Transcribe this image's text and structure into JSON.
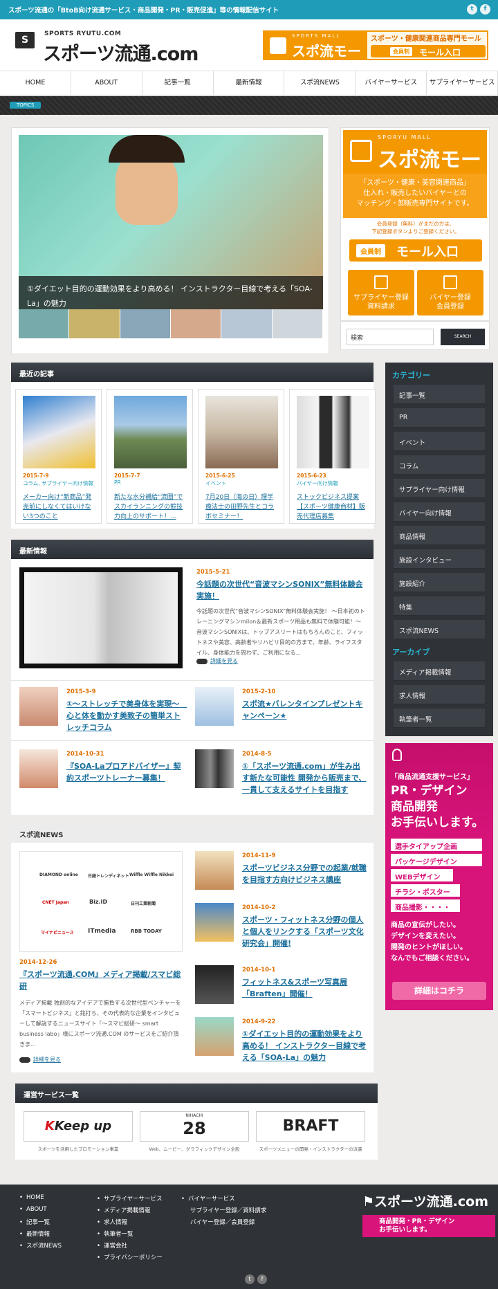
{
  "topbar": {
    "text": "スポーツ流通の「BtoB向け流通サービス・商品開発・PR・販売促進」等の情報配信サイト"
  },
  "header": {
    "logo_sub": "SPORTS RYUTU.COM",
    "logo_main": "スポーツ流通.com",
    "logo_flag": "S",
    "mall": {
      "en": "SPORTS MALL",
      "name": "スポ流モール",
      "desc": "スポーツ・健康関連商品専門モール",
      "tag": "会員制",
      "enter": "モール入口"
    }
  },
  "nav": [
    "HOME",
    "ABOUT",
    "記事一覧",
    "最新情報",
    "スポ流NEWS",
    "バイヤーサービス",
    "サプライヤーサービス"
  ],
  "topics_label": "TOPICS",
  "hero": {
    "caption": "①ダイエット目的の運動効果をより高める！ インストラクター目線で考える「SOA-La」の魅力"
  },
  "mall_side": {
    "en": "SPORYU MALL",
    "name": "スポ流モール",
    "desc1": "「スポーツ・健康・美容関連商品」",
    "desc2": "仕入れ・販売したいバイヤーとの",
    "desc3": "マッチング・卸販売専門サイトです。",
    "note1": "会員登録（無料）がまだの方は、",
    "note2": "下記登録ボタンよりご登録ください。",
    "tag": "会員制",
    "enter": "モール入口",
    "btn1a": "サプライヤー登録",
    "btn1b": "資料請求",
    "btn2a": "バイヤー登録",
    "btn2b": "会員登録"
  },
  "search": {
    "value": "検索",
    "button": "SEARCH"
  },
  "recent": {
    "title": "最近の記事",
    "items": [
      {
        "date": "2015-7-9",
        "cat": "コラム, サプライヤー向け情報",
        "title": "メーカー向け“新商品”発売前にしなくてはいけない3つのこと"
      },
      {
        "date": "2015-7-7",
        "cat": "PR",
        "title": "新たな水分補給“流圏”でスカイランニングの競技力向上のサポート！..."
      },
      {
        "date": "2015-6-25",
        "cat": "イベント",
        "title": "7月20日（海の日）理学療法士の田野先生とコラボセミナー！"
      },
      {
        "date": "2015-6-23",
        "cat": "バイヤー向け情報",
        "title": "ストックビジネス提案 【スポーツ健康商材】販売代理店募集"
      }
    ]
  },
  "news": {
    "title": "最新情報",
    "main": {
      "date": "2015-5-21",
      "title": "今話題の次世代“音波マシンSONIX”無料体験会実施！",
      "body": "今話題の次世代“音波マシンSONIX”無料体験会実施！ 〜日本初のトレーニングマシンmilon＆最新スポーツ用品も無料で体験可能！〜 音波マシンSONIXは、トップアスリートはもちろんのこと、フィットネスや美容、高齢者やリハビリ目的の方まで、年齢、ライフスタイル、身体能力を問わず、ご利用になる...",
      "more": "詳細を見る"
    },
    "items": [
      {
        "date": "2015-3-9",
        "title": "①〜ストレッチで美身体を実現〜　心と体を動かす美致子の簡単ストレッチコラム"
      },
      {
        "date": "2015-2-10",
        "title": "スポ流★バレンタインプレゼントキャンペーン★"
      },
      {
        "date": "2014-10-31",
        "title": "『SOA-Laプロアドバイザー』契約スポーツトレーナー募集！"
      },
      {
        "date": "2014-8-5",
        "title": "①「スポーツ流通.com」が生み出す新たな可能性 開発から販売まで、一貫して支えるサイトを目指す"
      }
    ]
  },
  "sidebar": {
    "cat_title": "カテゴリー",
    "categories": [
      "記事一覧",
      "PR",
      "イベント",
      "コラム",
      "サプライヤー向け情報",
      "バイヤー向け情報",
      "商品情報",
      "施設インタビュー",
      "施設紹介",
      "特集",
      "スポ流NEWS"
    ],
    "arch_title": "アーカイブ",
    "archives": [
      "メディア掲載情報",
      "求人情報",
      "執筆者一覧"
    ]
  },
  "pr_banner": {
    "head": "「商品流通支援サービス」",
    "l1": "PR・デザイン",
    "l2": "商品開発",
    "l3": "お手伝いします。",
    "items": [
      "選手タイアップ企画",
      "パッケージデザイン",
      "WEBデザイン",
      "チラシ・ポスター",
      "商品撮影・・・・"
    ],
    "m1": "商品の宣伝がしたい。",
    "m2": "デザインを変えたい。",
    "m3": "開発のヒントがほしい。",
    "m4": "なんでもご相談ください。",
    "btn": "詳細はコチラ"
  },
  "spo_news": {
    "title": "スポ流NEWS",
    "logos": [
      "DIAMOND online",
      "日経トレンディネット",
      "Wiffle Wiffle Nikkei",
      "CNET Japan",
      "Biz.ID",
      "日刊工業新聞",
      "マイナビニュース",
      "ITmedia",
      "RBB TODAY"
    ],
    "main": {
      "date": "2014-12-26",
      "title": "『スポーツ流通.COM』メディア掲載/スマビ総研",
      "body": "メディア掲載 独創的なアイデアで勝負する次世代型ベンチャーを「スマートビジネス」と銘打ち、その代表的な企業をインタビューして解説するニュースサイト「〜スマビ総研〜 smart business labo」様にスポーツ流通.COM のサービスをご紹介頂きま...",
      "more": "詳細を見る"
    },
    "items": [
      {
        "date": "2014-11-9",
        "title": "スポーツビジネス分野での起業/就職を目指す方向けビジネス講座"
      },
      {
        "date": "2014-10-2",
        "title": "スポーツ・フィットネス分野の個人と個人をリンクする「スポーツ文化研究会」開催!"
      },
      {
        "date": "2014-10-1",
        "title": "フィットネス&スポーツ写真展「Braften」開催！"
      },
      {
        "date": "2014-9-22",
        "title": "①ダイエット目的の運動効果をより高める！ インストラクター目線で考える「SOA-La」の魅力"
      }
    ]
  },
  "services": {
    "title": "運営サービス一覧",
    "items": [
      {
        "logo": "Keep up",
        "caption": "スポーツを活用したプロモーション事業"
      },
      {
        "logo": "28",
        "logo_sub": "NIHACHI",
        "caption": "Web、ムービー、グラフィックデザイン全般"
      },
      {
        "logo": "BRAFT",
        "caption": "スポーツメニューの開発・インストラクターの派遣"
      }
    ]
  },
  "footer": {
    "col1": [
      "HOME",
      "ABOUT",
      "記事一覧",
      "最新情報",
      "スポ流NEWS"
    ],
    "col2": [
      "サプライヤーサービス",
      "メディア掲載情報",
      "求人情報",
      "執筆者一覧",
      "運営会社",
      "プライバシーポリシー"
    ],
    "col3": [
      "バイヤーサービス"
    ],
    "col3_sub": [
      "サプライヤー登録／資料請求",
      "バイヤー登録／会員登録"
    ],
    "logo": "スポーツ流通.com",
    "banner1": "商品開発・PR・デザイン",
    "banner2": "お手伝いします。"
  },
  "colors": {
    "teal": "#1f9cb8",
    "orange": "#f39800",
    "magenta": "#d8147a",
    "dark": "#2f3338"
  }
}
